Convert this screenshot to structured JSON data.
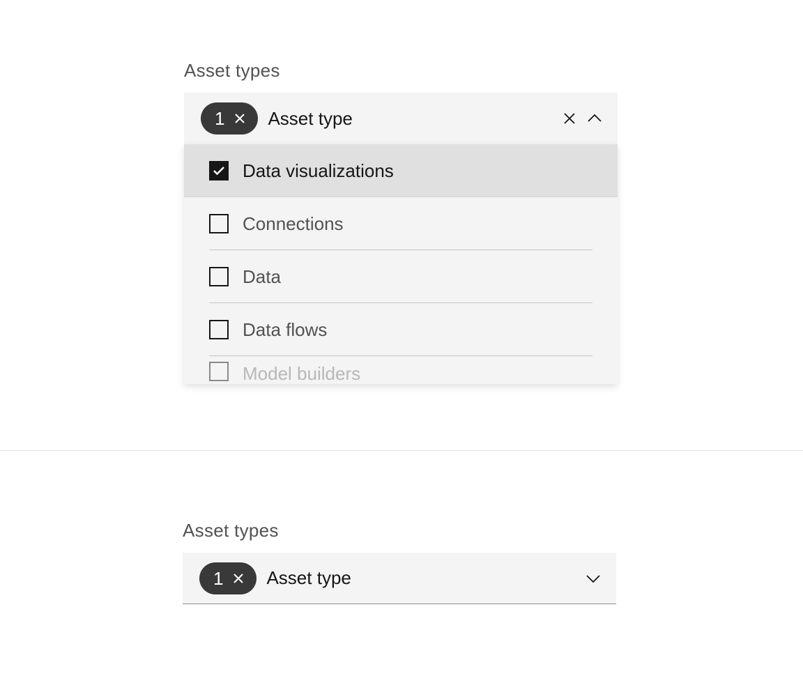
{
  "section1": {
    "label": "Asset types",
    "count": "1",
    "placeholder": "Asset type",
    "options": [
      {
        "label": "Data visualizations",
        "checked": true
      },
      {
        "label": "Connections",
        "checked": false
      },
      {
        "label": "Data",
        "checked": false
      },
      {
        "label": "Data flows",
        "checked": false
      },
      {
        "label": "Model builders",
        "checked": false
      }
    ]
  },
  "section2": {
    "label": "Asset types",
    "count": "1",
    "placeholder": "Asset type"
  }
}
